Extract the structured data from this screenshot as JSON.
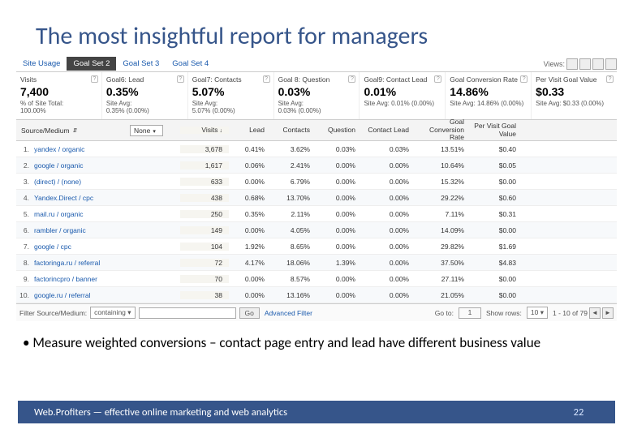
{
  "title": "The most insightful report for managers",
  "tabs": {
    "site_usage": "Site Usage",
    "goal2": "Goal Set 2",
    "goal3": "Goal Set 3",
    "goal4": "Goal Set 4"
  },
  "views_label": "Views:",
  "metrics": [
    {
      "label": "Visits",
      "value": "7,400",
      "sub1": "% of Site Total:",
      "sub2": "100.00%"
    },
    {
      "label": "Goal6: Lead",
      "value": "0.35%",
      "sub1": "Site Avg:",
      "sub2": "0.35% (0.00%)"
    },
    {
      "label": "Goal7: Contacts",
      "value": "5.07%",
      "sub1": "Site Avg:",
      "sub2": "5.07% (0.00%)"
    },
    {
      "label": "Goal 8: Question",
      "value": "0.03%",
      "sub1": "Site Avg:",
      "sub2": "0.03% (0.00%)"
    },
    {
      "label": "Goal9: Contact Lead",
      "value": "0.01%",
      "sub1": "Site Avg: 0.01% (0.00%)",
      "sub2": ""
    },
    {
      "label": "Goal Conversion Rate",
      "value": "14.86%",
      "sub1": "Site Avg: 14.86% (0.00%)",
      "sub2": ""
    },
    {
      "label": "Per Visit Goal Value",
      "value": "$0.33",
      "sub1": "Site Avg: $0.33 (0.00%)",
      "sub2": ""
    }
  ],
  "headers": {
    "source": "Source/Medium",
    "none": "None",
    "visits": "Visits",
    "lead": "Lead",
    "contacts": "Contacts",
    "question": "Question",
    "contact_lead": "Contact Lead",
    "gcr": "Goal Conversion Rate",
    "pvgv": "Per Visit Goal Value"
  },
  "rows": [
    {
      "idx": "1.",
      "src": "yandex / organic",
      "visits": "3,678",
      "lead": "0.41%",
      "contacts": "3.62%",
      "question": "0.03%",
      "contact_lead": "0.03%",
      "gcr": "13.51%",
      "pvgv": "$0.40"
    },
    {
      "idx": "2.",
      "src": "google / organic",
      "visits": "1,617",
      "lead": "0.06%",
      "contacts": "2.41%",
      "question": "0.00%",
      "contact_lead": "0.00%",
      "gcr": "10.64%",
      "pvgv": "$0.05"
    },
    {
      "idx": "3.",
      "src": "(direct) / (none)",
      "visits": "633",
      "lead": "0.00%",
      "contacts": "6.79%",
      "question": "0.00%",
      "contact_lead": "0.00%",
      "gcr": "15.32%",
      "pvgv": "$0.00"
    },
    {
      "idx": "4.",
      "src": "Yandex.Direct / cpc",
      "visits": "438",
      "lead": "0.68%",
      "contacts": "13.70%",
      "question": "0.00%",
      "contact_lead": "0.00%",
      "gcr": "29.22%",
      "pvgv": "$0.60"
    },
    {
      "idx": "5.",
      "src": "mail.ru / organic",
      "visits": "250",
      "lead": "0.35%",
      "contacts": "2.11%",
      "question": "0.00%",
      "contact_lead": "0.00%",
      "gcr": "7.11%",
      "pvgv": "$0.31"
    },
    {
      "idx": "6.",
      "src": "rambler / organic",
      "visits": "149",
      "lead": "0.00%",
      "contacts": "4.05%",
      "question": "0.00%",
      "contact_lead": "0.00%",
      "gcr": "14.09%",
      "pvgv": "$0.00"
    },
    {
      "idx": "7.",
      "src": "google / cpc",
      "visits": "104",
      "lead": "1.92%",
      "contacts": "8.65%",
      "question": "0.00%",
      "contact_lead": "0.00%",
      "gcr": "29.82%",
      "pvgv": "$1.69"
    },
    {
      "idx": "8.",
      "src": "factoringa.ru / referral",
      "visits": "72",
      "lead": "4.17%",
      "contacts": "18.06%",
      "question": "1.39%",
      "contact_lead": "0.00%",
      "gcr": "37.50%",
      "pvgv": "$4.83"
    },
    {
      "idx": "9.",
      "src": "factorincpro / banner",
      "visits": "70",
      "lead": "0.00%",
      "contacts": "8.57%",
      "question": "0.00%",
      "contact_lead": "0.00%",
      "gcr": "27.11%",
      "pvgv": "$0.00"
    },
    {
      "idx": "10.",
      "src": "google.ru / referral",
      "visits": "38",
      "lead": "0.00%",
      "contacts": "13.16%",
      "question": "0.00%",
      "contact_lead": "0.00%",
      "gcr": "21.05%",
      "pvgv": "$0.00"
    }
  ],
  "footer": {
    "filter_label": "Filter Source/Medium:",
    "filter_mode": "containing ▾",
    "go": "Go",
    "advanced": "Advanced Filter",
    "goto": "Go to:",
    "goto_val": "1",
    "show_rows": "Show rows:",
    "rows_val": "10 ▾",
    "range": "1 - 10 of 79"
  },
  "bullet": "Measure weighted conversions – contact page entry and lead have different business value",
  "bottom": {
    "text": "Web.Profiters — effective online marketing and web analytics",
    "page": "22"
  }
}
